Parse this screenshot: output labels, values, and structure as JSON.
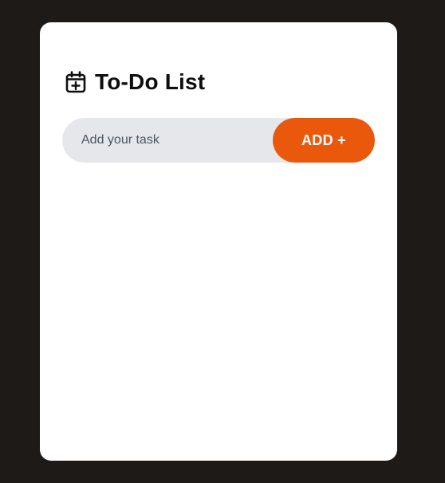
{
  "app": {
    "title": "To-Do List",
    "title_icon": "calendar-plus-icon"
  },
  "task_input": {
    "placeholder": "Add your task",
    "value": ""
  },
  "add_button": {
    "label": "ADD +"
  },
  "tasks": [],
  "colors": {
    "page_background": "#1e1a17",
    "card_background": "#ffffff",
    "input_background": "#e5e7eb",
    "accent": "#ea580c",
    "title_text": "#0e0e0e"
  }
}
